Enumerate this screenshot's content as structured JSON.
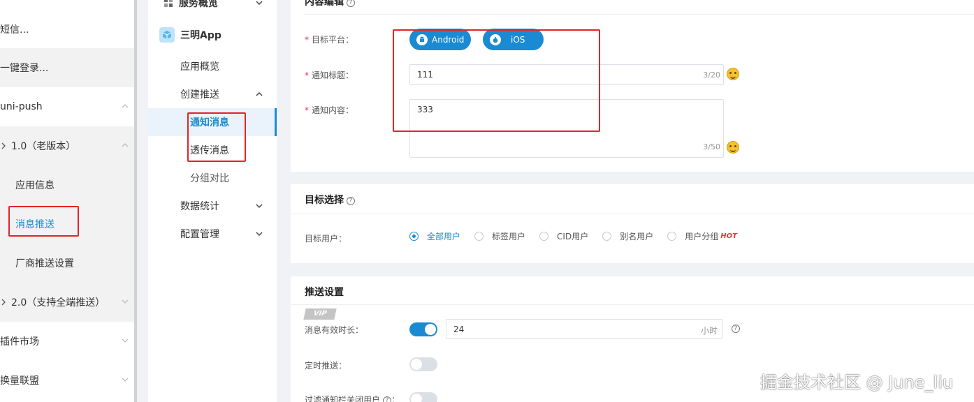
{
  "left_nav": {
    "items": [
      {
        "label": "短信..."
      },
      {
        "label": "一键登录..."
      },
      {
        "label": "uni-push"
      },
      {
        "label": "1.0（老版本）"
      },
      {
        "label": "应用信息"
      },
      {
        "label": "消息推送"
      },
      {
        "label": "厂商推送设置"
      },
      {
        "label": "2.0（支持全端推送）"
      },
      {
        "label": "插件市场"
      },
      {
        "label": "换量联盟"
      }
    ]
  },
  "mid_nav": {
    "service_overview": "服务概览",
    "app_name": "三明App",
    "app_overview": "应用概览",
    "create_push": "创建推送",
    "notify_msg": "通知消息",
    "passthrough_msg": "透传消息",
    "group_compare": "分组对比",
    "data_stats": "数据统计",
    "config_mgmt": "配置管理"
  },
  "content_edit": {
    "title": "内容编辑",
    "platform_label": "目标平台：",
    "platforms": [
      "Android",
      "iOS"
    ],
    "title_label": "通知标题：",
    "title_value": "111",
    "title_count": "3/20",
    "content_label": "通知内容：",
    "content_value": "333",
    "content_count": "3/50"
  },
  "target": {
    "title": "目标选择",
    "user_label": "目标用户：",
    "options": [
      "全部用户",
      "标签用户",
      "CID用户",
      "别名用户",
      "用户分组"
    ],
    "selected": "全部用户",
    "hot_badge": "HOT"
  },
  "push_settings": {
    "title": "推送设置",
    "vip_badge": "VIP",
    "ttl_label": "消息有效时长：",
    "ttl_value": "24",
    "ttl_unit": "小时",
    "ttl_enabled": true,
    "scheduled_label": "定时推送：",
    "scheduled_enabled": false,
    "filter_label": "过滤通知栏关闭用户",
    "filter_enabled": false
  },
  "watermark": "掘金技术社区 @ June_liu",
  "colors": {
    "accent": "#1a8ad3",
    "annotation_red": "#e4232a",
    "hot": "#e4393c"
  }
}
